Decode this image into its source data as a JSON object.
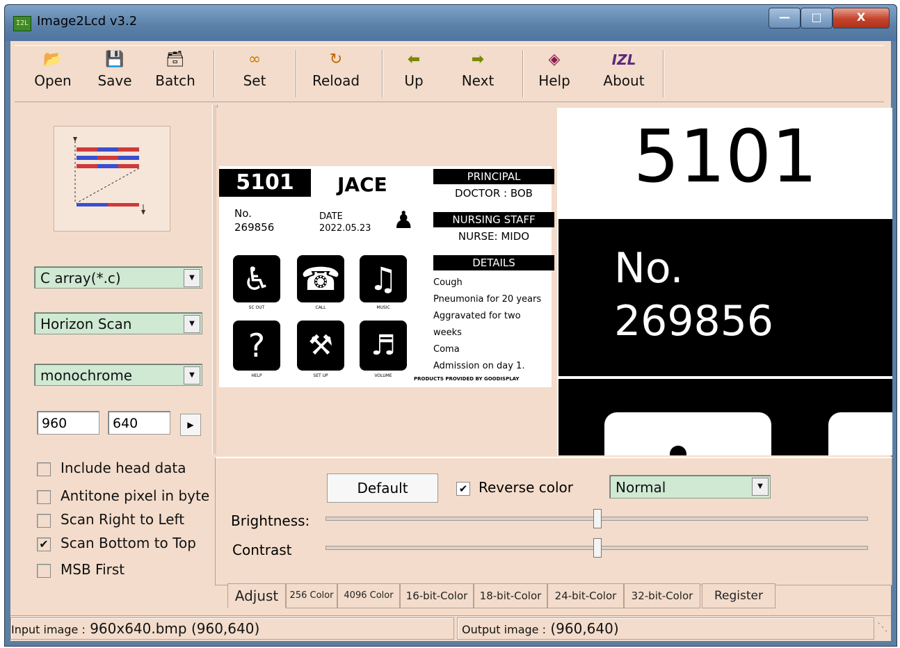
{
  "window": {
    "title": "Image2Lcd v3.2",
    "app_icon_text": "I2L"
  },
  "toolbar": {
    "open_label": "Open",
    "save_label": "Save",
    "batch_label": "Batch",
    "set_label": "Set",
    "reload_label": "Reload",
    "up_label": "Up",
    "next_label": "Next",
    "help_label": "Help",
    "about_label": "About",
    "about_icon_text": "IZL"
  },
  "settings": {
    "output_format": "C array(*.c)",
    "scan_mode": "Horizon Scan",
    "color_mode": "monochrome",
    "width": "960",
    "height": "640",
    "options": [
      {
        "label": "Include head data",
        "checked": false
      },
      {
        "label": "Antitone pixel in byte",
        "checked": false
      },
      {
        "label": "Scan Right to Left",
        "checked": false
      },
      {
        "label": "Scan Bottom to Top",
        "checked": true
      },
      {
        "label": "MSB First",
        "checked": false
      }
    ]
  },
  "preview": {
    "id_number": "5101",
    "name": "JACE",
    "no_label": "No.",
    "no_value": "269856",
    "date_label": "DATE",
    "date_value": "2022.05.23",
    "principal_header": "PRINCIPAL",
    "principal_value": "DOCTOR : BOB",
    "nursing_header": "NURSING STAFF",
    "nursing_value": "NURSE: MIDO",
    "details_header": "DETAILS",
    "details": [
      "Cough",
      "Pneumonia for 20 years",
      "Aggravated for two weeks",
      "Coma",
      "Admission on day 1."
    ],
    "footer": "PRODUCTS PROVIDED BY GOODISPLAY",
    "tile_labels": [
      "SC OUT",
      "CALL",
      "MUSIC",
      "HELP",
      "SET UP",
      "VOLUME"
    ]
  },
  "output_preview": {
    "id_number": "5101",
    "no_label": "No.",
    "no_value": "269856"
  },
  "adjust": {
    "default_label": "Default",
    "reverse_label": "Reverse color",
    "reverse_checked": true,
    "mode": "Normal",
    "brightness_label": "Brightness:",
    "contrast_label": "Contrast",
    "brightness": 0.5,
    "contrast": 0.5
  },
  "tabs": [
    "Adjust",
    "256 Color",
    "4096 Color",
    "16-bit-Color",
    "18-bit-Color",
    "24-bit-Color",
    "32-bit-Color",
    "Register"
  ],
  "status": {
    "input_label": "Input image :",
    "input_value": "960x640.bmp (960,640)",
    "output_label": "Output image :",
    "output_value": "(960,640)"
  },
  "colors": {
    "panel": "#f3dccb",
    "combo": "#cfe9d3",
    "titlebar": "#5a80a8",
    "close": "#c3432a"
  }
}
